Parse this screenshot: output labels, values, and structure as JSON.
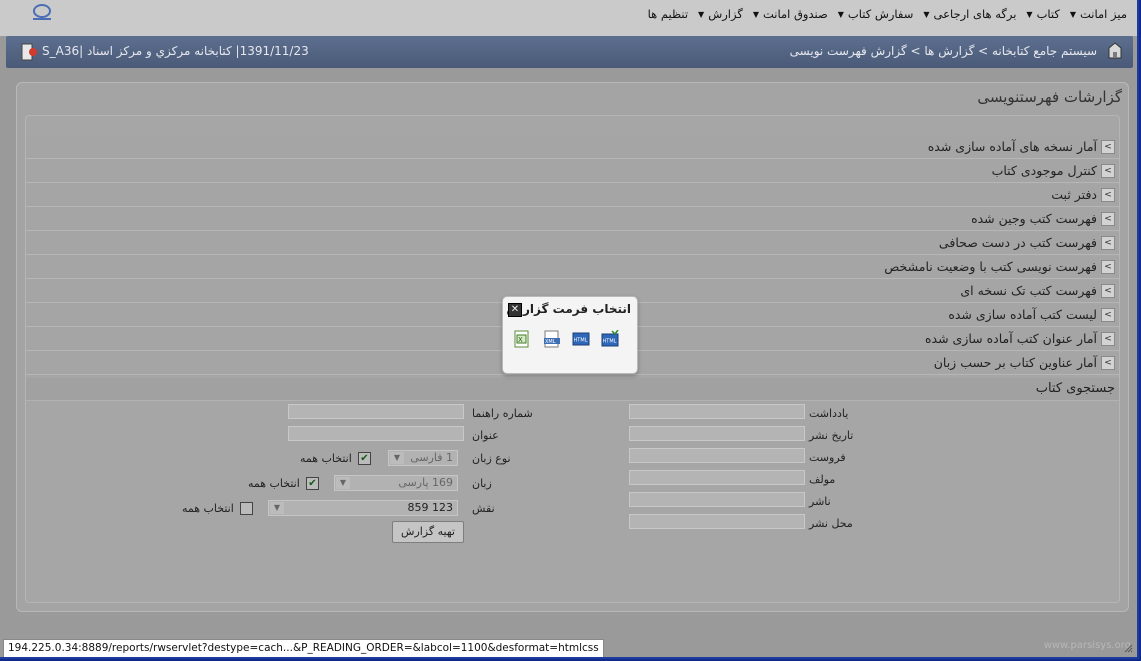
{
  "menu": [
    {
      "label": "میز امانت"
    },
    {
      "label": "کتاب"
    },
    {
      "label": "برگه های ارجاعی"
    },
    {
      "label": "سفارش کتاب"
    },
    {
      "label": "صندوق امانت"
    },
    {
      "label": "گزارش"
    },
    {
      "label": "تنظیم ها"
    }
  ],
  "breadcrumb": "سیستم جامع کتابخانه > گزارش ها > گزارش فهرست نویسی",
  "status_info": "1391/11/23| کتابخانه مرکزي و مرکز اسناد |S_A36",
  "panel_title": "گزارشات فهرستنویسی",
  "reports": [
    {
      "label": "آمار نسخه های آماده سازی شده"
    },
    {
      "label": "کنترل موجودی کتاب"
    },
    {
      "label": "دفتر ثبت"
    },
    {
      "label": "فهرست کتب وجین شده"
    },
    {
      "label": "فهرست کتب در دست صحافی"
    },
    {
      "label": "فهرست نویسی کتب با وضعیت نامشخص"
    },
    {
      "label": "فهرست کتب تک نسخه ای"
    },
    {
      "label": "لیست کتب آماده سازی شده"
    },
    {
      "label": "آمار عنوان کتب آماده سازی شده"
    },
    {
      "label": "آمار عناوین کتاب بر حسب زبان"
    }
  ],
  "search": {
    "title": "جستجوی کتاب",
    "right_labels": [
      "یادداشت",
      "تاریخ نشر",
      "فروست",
      "مولف",
      "ناشر",
      "محل نشر"
    ],
    "call_number_label": "شماره راهنما",
    "title_label": "عنوان",
    "lang_type_label": "نوع زبان",
    "lang_type_value": "1 فارسی",
    "language_label": "زبان",
    "language_value": "169 پارسی",
    "role_label": "نقش",
    "role_value": "123 859",
    "select_all": "انتخاب همه",
    "submit": "تهیه گزارش"
  },
  "modal": {
    "title": "انتخاب فرمت گزارش",
    "formats": [
      "excel-icon",
      "xml-icon",
      "html-icon",
      "html-css-icon"
    ]
  },
  "statusbar": "194.225.0.34:8889/reports/rwservlet?destype=cach...&P_READING_ORDER=&labcol=1100&desformat=htmlcss",
  "watermark": "www.parsisys.org",
  "colors": {
    "infobar": "#4f607f",
    "panel": "#a5a5a5",
    "modal": "#f4f4f4",
    "frame_border": "#1d3a9c"
  }
}
